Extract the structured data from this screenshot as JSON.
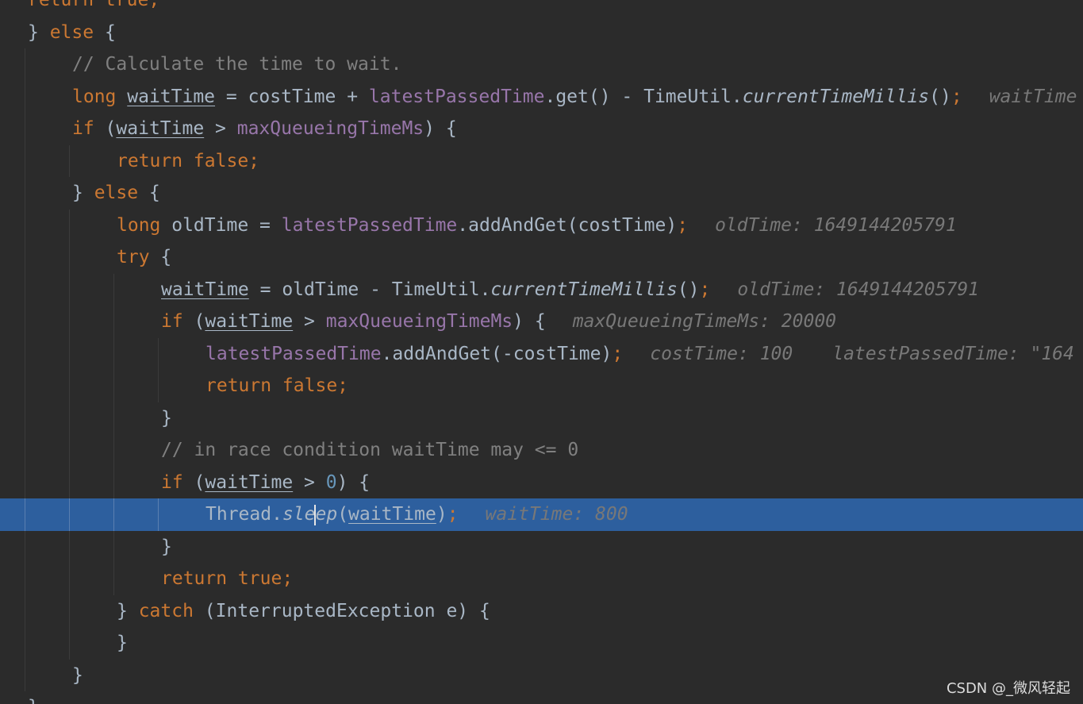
{
  "colors": {
    "background": "#2b2b2b",
    "current_line": "#2d5f9e",
    "keyword": "#cc7832",
    "field": "#9876aa",
    "comment": "#808080",
    "number": "#6897bb",
    "text": "#a9b7c6",
    "inlay_hint": "#787878"
  },
  "watermark": "CSDN @_微风轻起",
  "lines": [
    {
      "tokens": [
        {
          "t": "return true;",
          "c": "kw"
        }
      ]
    },
    {
      "tokens": [
        {
          "t": "} "
        },
        {
          "t": "else",
          "c": "kw"
        },
        {
          "t": " {"
        }
      ]
    },
    {
      "tokens": [
        {
          "t": "// Calculate the time to wait.",
          "c": "comment"
        }
      ]
    },
    {
      "tokens": [
        {
          "t": "long",
          "c": "kw"
        },
        {
          "t": " "
        },
        {
          "t": "waitTime",
          "c": "var"
        },
        {
          "t": " = costTime + "
        },
        {
          "t": "latestPassedTime",
          "c": "field"
        },
        {
          "t": ".get() - TimeUtil."
        },
        {
          "t": "currentTimeMillis",
          "c": "static"
        },
        {
          "t": "()"
        },
        {
          "t": ";",
          "c": "kw"
        }
      ],
      "hints": [
        "waitTime"
      ]
    },
    {
      "tokens": [
        {
          "t": "if",
          "c": "kw"
        },
        {
          "t": " ("
        },
        {
          "t": "waitTime",
          "c": "var"
        },
        {
          "t": " > "
        },
        {
          "t": "maxQueueingTimeMs",
          "c": "field"
        },
        {
          "t": ") {"
        }
      ]
    },
    {
      "tokens": [
        {
          "t": "return false;",
          "c": "kw"
        }
      ]
    },
    {
      "tokens": [
        {
          "t": "} "
        },
        {
          "t": "else",
          "c": "kw"
        },
        {
          "t": " {"
        }
      ]
    },
    {
      "tokens": [
        {
          "t": "long",
          "c": "kw"
        },
        {
          "t": " oldTime = "
        },
        {
          "t": "latestPassedTime",
          "c": "field"
        },
        {
          "t": ".addAndGet(costTime)"
        },
        {
          "t": ";",
          "c": "kw"
        }
      ],
      "hints": [
        "oldTime: 1649144205791"
      ]
    },
    {
      "tokens": [
        {
          "t": "try",
          "c": "kw"
        },
        {
          "t": " {"
        }
      ]
    },
    {
      "tokens": [
        {
          "t": "waitTime",
          "c": "var"
        },
        {
          "t": " = oldTime - TimeUtil."
        },
        {
          "t": "currentTimeMillis",
          "c": "static"
        },
        {
          "t": "()"
        },
        {
          "t": ";",
          "c": "kw"
        }
      ],
      "hints": [
        "oldTime: 1649144205791"
      ]
    },
    {
      "tokens": [
        {
          "t": "if",
          "c": "kw"
        },
        {
          "t": " ("
        },
        {
          "t": "waitTime",
          "c": "var"
        },
        {
          "t": " > "
        },
        {
          "t": "maxQueueingTimeMs",
          "c": "field"
        },
        {
          "t": ") {"
        }
      ],
      "hints": [
        "maxQueueingTimeMs: 20000"
      ]
    },
    {
      "tokens": [
        {
          "t": "latestPassedTime",
          "c": "field"
        },
        {
          "t": ".addAndGet(-costTime)"
        },
        {
          "t": ";",
          "c": "kw"
        }
      ],
      "hints": [
        "costTime: 100",
        "latestPassedTime: \"164"
      ]
    },
    {
      "tokens": [
        {
          "t": "return false;",
          "c": "kw"
        }
      ]
    },
    {
      "tokens": [
        {
          "t": "}"
        }
      ]
    },
    {
      "tokens": [
        {
          "t": "// in race condition waitTime may <= 0",
          "c": "comment"
        }
      ]
    },
    {
      "tokens": [
        {
          "t": "if",
          "c": "kw"
        },
        {
          "t": " ("
        },
        {
          "t": "waitTime",
          "c": "var"
        },
        {
          "t": " > "
        },
        {
          "t": "0",
          "c": "num"
        },
        {
          "t": ") {"
        }
      ]
    },
    {
      "tokens": [
        {
          "t": "Thread."
        },
        {
          "t": "sle",
          "c": "static"
        },
        {
          "caret": true
        },
        {
          "t": "ep",
          "c": "static"
        },
        {
          "t": "("
        },
        {
          "t": "waitTime",
          "c": "var"
        },
        {
          "t": ")"
        },
        {
          "t": ";",
          "c": "kw"
        }
      ],
      "hints": [
        "waitTime: 800"
      ],
      "current": true
    },
    {
      "tokens": [
        {
          "t": "}"
        }
      ]
    },
    {
      "tokens": [
        {
          "t": "return true;",
          "c": "kw"
        }
      ]
    },
    {
      "tokens": [
        {
          "t": "} "
        },
        {
          "t": "catch",
          "c": "kw"
        },
        {
          "t": " (InterruptedException e) {"
        }
      ]
    },
    {
      "tokens": [
        {
          "t": "}"
        }
      ]
    },
    {
      "tokens": [
        {
          "t": "}"
        }
      ]
    },
    {
      "tokens": [
        {
          "t": "}"
        }
      ]
    }
  ]
}
